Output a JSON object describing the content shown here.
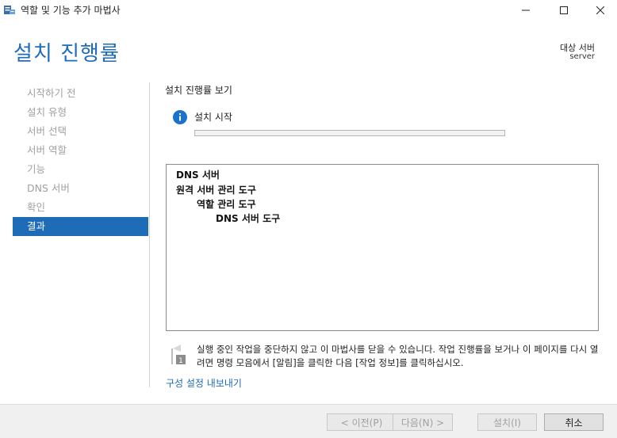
{
  "window": {
    "title": "역할 및 기능 추가 마법사"
  },
  "header": {
    "page_title": "설치 진행률",
    "destination_label": "대상 서버",
    "destination_value": "server"
  },
  "nav": {
    "items": [
      {
        "label": "시작하기 전"
      },
      {
        "label": "설치 유형"
      },
      {
        "label": "서버 선택"
      },
      {
        "label": "서버 역할"
      },
      {
        "label": "기능"
      },
      {
        "label": "DNS 서버"
      },
      {
        "label": "확인"
      },
      {
        "label": "결과"
      }
    ],
    "active_index": 7
  },
  "content": {
    "section_label": "설치 진행률 보기",
    "status_text": "설치 시작",
    "progress_value": 0,
    "results": [
      "DNS 서버",
      "원격 서버 관리 도구",
      "역할 관리 도구",
      "DNS 서버 도구"
    ],
    "note_text": "실행 중인 작업을 중단하지 않고 이 마법사를 닫을 수 있습니다. 작업 진행률을 보거나 이 페이지를 다시 열려면 명령 모음에서 [알림]을 클릭한 다음 [작업 정보]를 클릭하십시오.",
    "export_link": "구성 설정 내보내기"
  },
  "footer": {
    "prev_label": "< 이전(P)",
    "next_label": "다음(N) >",
    "install_label": "설치(I)",
    "cancel_label": "취소"
  },
  "colors": {
    "accent": "#1e6bb8",
    "info_icon": "#1a73c8"
  }
}
